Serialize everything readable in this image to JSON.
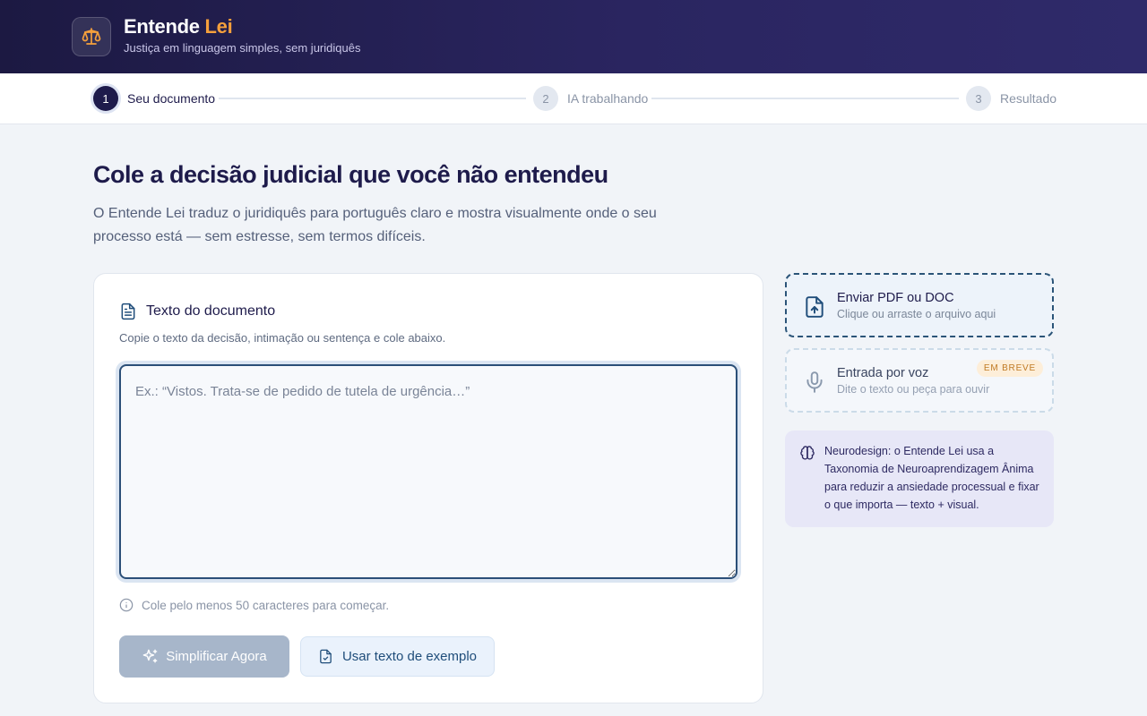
{
  "header": {
    "brand_main": "Entende",
    "brand_accent": "Lei",
    "tagline": "Justiça em linguagem simples, sem juridiquês",
    "logo_icon": "scales-icon"
  },
  "stepper": {
    "steps": [
      {
        "number": "1",
        "label": "Seu documento",
        "state": "active"
      },
      {
        "number": "2",
        "label": "IA trabalhando",
        "state": "inactive"
      },
      {
        "number": "3",
        "label": "Resultado",
        "state": "inactive"
      }
    ]
  },
  "hero": {
    "title": "Cole a decisão judicial que você não entendeu",
    "subtitle": "O Entende Lei traduz o juridiquês para português claro e mostra visualmente onde o seu processo está — sem estresse, sem termos difíceis."
  },
  "document_card": {
    "title": "Texto do documento",
    "description": "Copie o texto da decisão, intimação ou sentença e cole abaixo.",
    "textarea": {
      "value": "",
      "placeholder": "Ex.: “Vistos. Trata-se de pedido de tutela de urgência…”"
    },
    "hint": "Cole pelo menos 50 caracteres para começar.",
    "primary_button": "Simplificar Agora",
    "secondary_button": "Usar texto de exemplo"
  },
  "side": {
    "upload": {
      "title": "Enviar PDF ou DOC",
      "subtitle": "Clique ou arraste o arquivo aqui",
      "icon": "file-upload-icon"
    },
    "voice": {
      "title": "Entrada por voz",
      "subtitle": "Dite o texto ou peça para ouvir",
      "badge": "EM BREVE",
      "icon": "microphone-icon"
    },
    "neurodesign": {
      "text": "Neurodesign: o Entende Lei usa a Taxonomia de Neuroaprendizagem Ânima para reduzir a ansiedade processual e fixar o que importa — texto + visual.",
      "icon": "brain-icon"
    }
  },
  "colors": {
    "brand_dark": "#1e1b4b",
    "accent_orange": "#f5a03c",
    "primary_disabled": "#a7b6ca",
    "link_blue": "#1f4d7a"
  }
}
